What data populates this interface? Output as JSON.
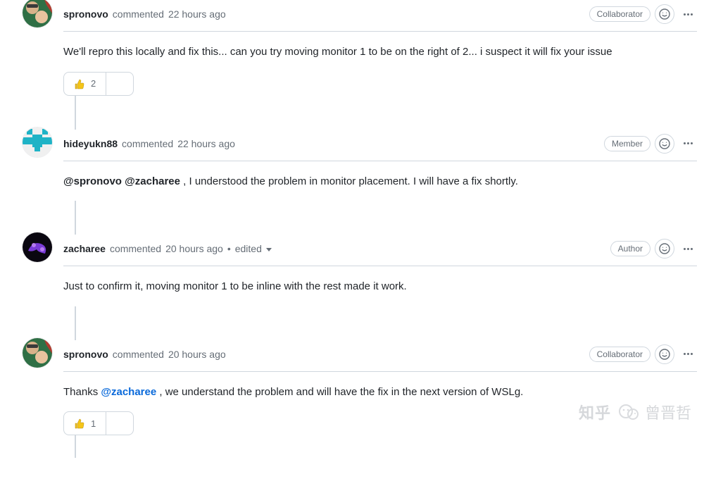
{
  "verbs": {
    "commented": "commented"
  },
  "roles": {
    "collaborator": "Collaborator",
    "member": "Member",
    "author": "Author"
  },
  "comments": [
    {
      "author": "spronovo",
      "age": "22 hours ago",
      "role": "collaborator",
      "edited": false,
      "body_plain": "We'll repro this locally and fix this... can you try moving monitor 1 to be on the right of 2... i suspect it will fix your issue",
      "reactions": {
        "thumbs_up": 2
      }
    },
    {
      "author": "hideyukn88",
      "age": "22 hours ago",
      "role": "member",
      "edited": false,
      "mentions": [
        "@spronovo",
        "@zacharee"
      ],
      "body_plain": "@spronovo @zacharee , I understood the problem in monitor placement. I will have a fix shortly.",
      "body_tail": " , I understood the problem in monitor placement. I will have a fix shortly.",
      "reactions": null
    },
    {
      "author": "zacharee",
      "age": "20 hours ago",
      "role": "author",
      "edited": true,
      "edited_label": "edited",
      "body_plain": "Just to confirm it, moving monitor 1 to be inline with the rest made it work.",
      "reactions": null
    },
    {
      "author": "spronovo",
      "age": "20 hours ago",
      "role": "collaborator",
      "edited": false,
      "body_head": "Thanks ",
      "mention_link": "@zacharee",
      "body_tail": ", we understand the problem and will have the fix in the next version of WSLg.",
      "body_plain": "Thanks @zacharee, we understand the problem and will have the fix in the next version of WSLg.",
      "reactions": {
        "thumbs_up": 1
      }
    }
  ],
  "watermark": {
    "brand": "知乎",
    "handle": "曾晋哲"
  }
}
